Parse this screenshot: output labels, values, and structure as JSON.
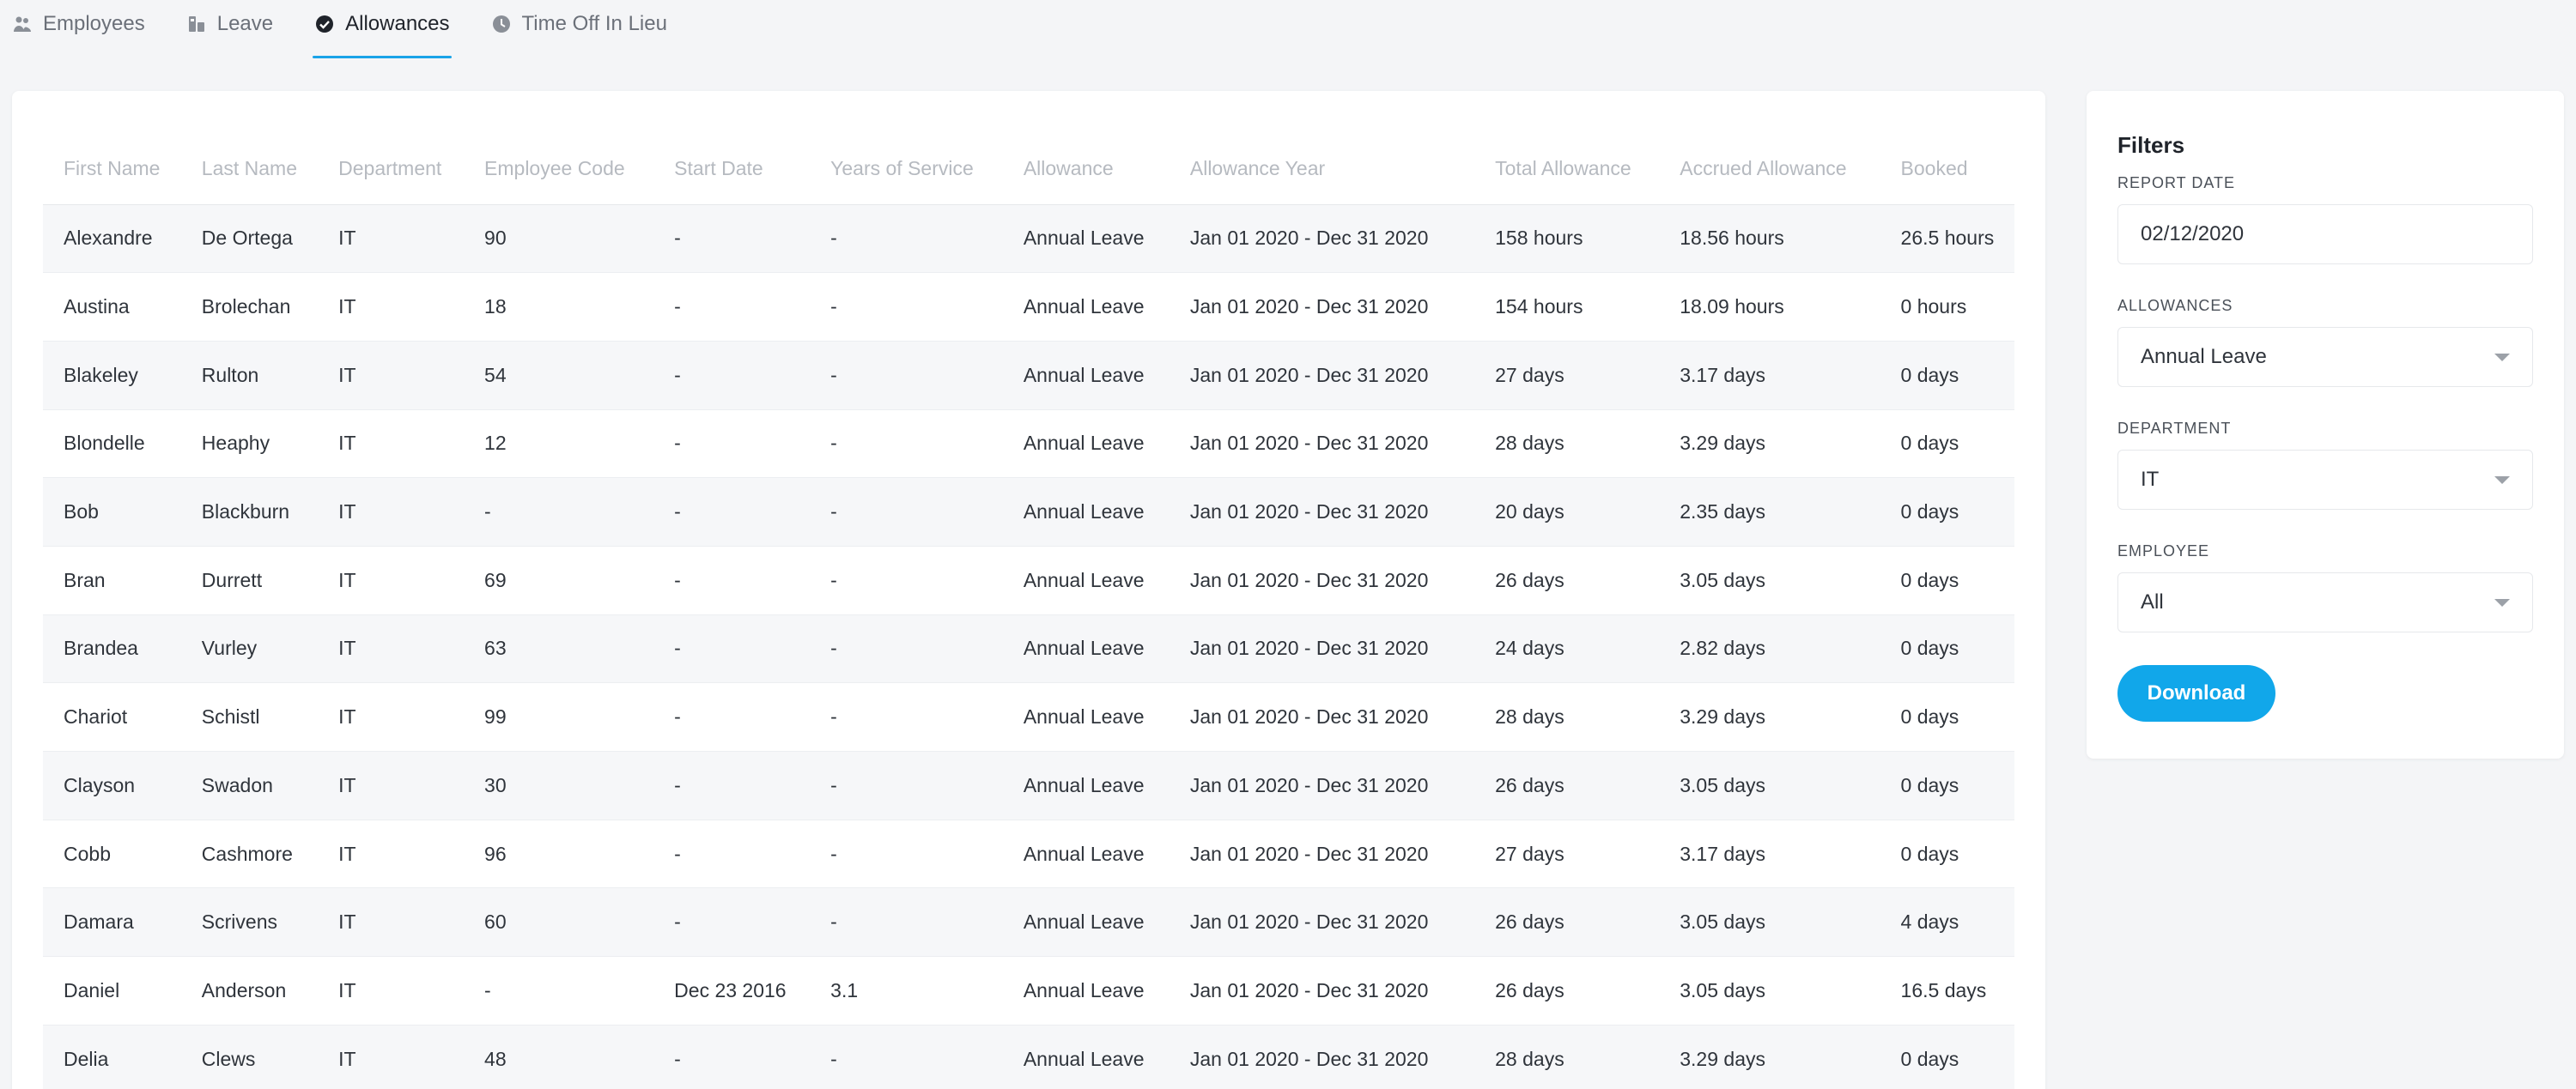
{
  "tabs": [
    {
      "label": "Employees",
      "icon": "people-icon",
      "active": false
    },
    {
      "label": "Leave",
      "icon": "leave-icon",
      "active": false
    },
    {
      "label": "Allowances",
      "icon": "check-circle-icon",
      "active": true
    },
    {
      "label": "Time Off In Lieu",
      "icon": "clock-icon",
      "active": false
    }
  ],
  "table": {
    "headers": [
      "First Name",
      "Last Name",
      "Department",
      "Employee Code",
      "Start Date",
      "Years of Service",
      "Allowance",
      "Allowance Year",
      "Total Allowance",
      "Accrued Allowance",
      "Booked"
    ],
    "rows": [
      [
        "Alexandre",
        "De Ortega",
        "IT",
        "90",
        "-",
        "-",
        "Annual Leave",
        "Jan 01 2020 - Dec 31 2020",
        "158 hours",
        "18.56 hours",
        "26.5 hours"
      ],
      [
        "Austina",
        "Brolechan",
        "IT",
        "18",
        "-",
        "-",
        "Annual Leave",
        "Jan 01 2020 - Dec 31 2020",
        "154 hours",
        "18.09 hours",
        "0 hours"
      ],
      [
        "Blakeley",
        "Rulton",
        "IT",
        "54",
        "-",
        "-",
        "Annual Leave",
        "Jan 01 2020 - Dec 31 2020",
        "27 days",
        "3.17 days",
        "0 days"
      ],
      [
        "Blondelle",
        "Heaphy",
        "IT",
        "12",
        "-",
        "-",
        "Annual Leave",
        "Jan 01 2020 - Dec 31 2020",
        "28 days",
        "3.29 days",
        "0 days"
      ],
      [
        "Bob",
        "Blackburn",
        "IT",
        "-",
        "-",
        "-",
        "Annual Leave",
        "Jan 01 2020 - Dec 31 2020",
        "20 days",
        "2.35 days",
        "0 days"
      ],
      [
        "Bran",
        "Durrett",
        "IT",
        "69",
        "-",
        "-",
        "Annual Leave",
        "Jan 01 2020 - Dec 31 2020",
        "26 days",
        "3.05 days",
        "0 days"
      ],
      [
        "Brandea",
        "Vurley",
        "IT",
        "63",
        "-",
        "-",
        "Annual Leave",
        "Jan 01 2020 - Dec 31 2020",
        "24 days",
        "2.82 days",
        "0 days"
      ],
      [
        "Chariot",
        "Schistl",
        "IT",
        "99",
        "-",
        "-",
        "Annual Leave",
        "Jan 01 2020 - Dec 31 2020",
        "28 days",
        "3.29 days",
        "0 days"
      ],
      [
        "Clayson",
        "Swadon",
        "IT",
        "30",
        "-",
        "-",
        "Annual Leave",
        "Jan 01 2020 - Dec 31 2020",
        "26 days",
        "3.05 days",
        "0 days"
      ],
      [
        "Cobb",
        "Cashmore",
        "IT",
        "96",
        "-",
        "-",
        "Annual Leave",
        "Jan 01 2020 - Dec 31 2020",
        "27 days",
        "3.17 days",
        "0 days"
      ],
      [
        "Damara",
        "Scrivens",
        "IT",
        "60",
        "-",
        "-",
        "Annual Leave",
        "Jan 01 2020 - Dec 31 2020",
        "26 days",
        "3.05 days",
        "4 days"
      ],
      [
        "Daniel",
        "Anderson",
        "IT",
        "-",
        "Dec 23 2016",
        "3.1",
        "Annual Leave",
        "Jan 01 2020 - Dec 31 2020",
        "26 days",
        "3.05 days",
        "16.5 days"
      ],
      [
        "Delia",
        "Clews",
        "IT",
        "48",
        "-",
        "-",
        "Annual Leave",
        "Jan 01 2020 - Dec 31 2020",
        "28 days",
        "3.29 days",
        "0 days"
      ]
    ]
  },
  "filters": {
    "title": "Filters",
    "report_date_label": "REPORT DATE",
    "report_date_value": "02/12/2020",
    "allowances_label": "ALLOWANCES",
    "allowances_value": "Annual Leave",
    "department_label": "DEPARTMENT",
    "department_value": "IT",
    "employee_label": "EMPLOYEE",
    "employee_value": "All",
    "download_label": "Download"
  },
  "colors": {
    "accent": "#11a7ea",
    "tab_underline": "#1aa3e8"
  }
}
